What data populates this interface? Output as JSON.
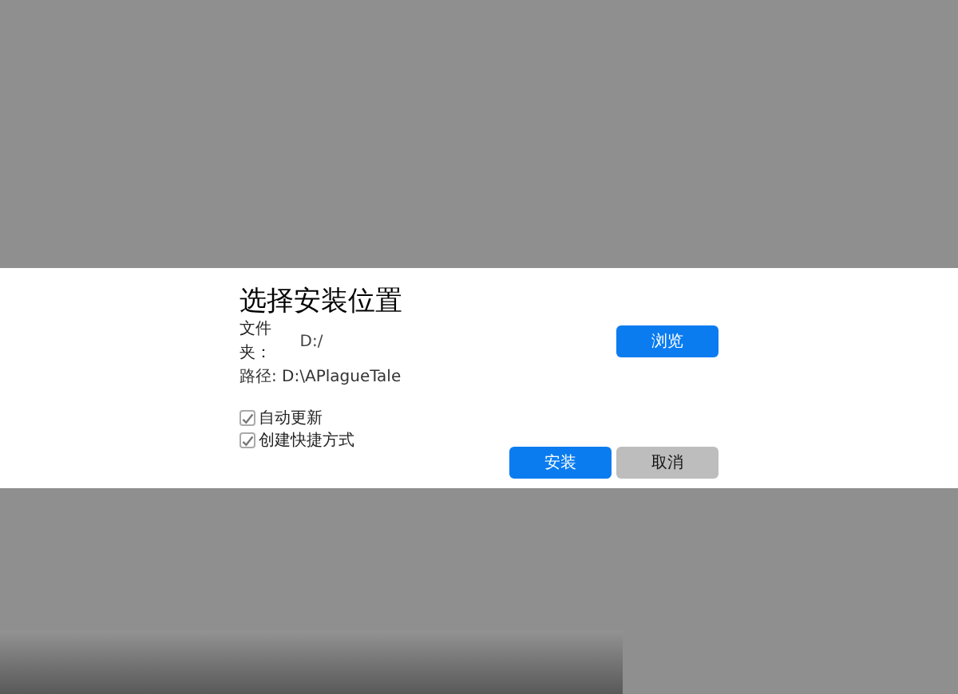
{
  "dialog": {
    "title": "选择安装位置",
    "folder": {
      "label": "文件夹：",
      "value": "D:/"
    },
    "browse_button": "浏览",
    "path": {
      "label": "路径:",
      "value": "D:\\APlagueTale"
    },
    "options": [
      {
        "label": "自动更新",
        "checked": true
      },
      {
        "label": "创建快捷方式",
        "checked": true
      }
    ],
    "buttons": [
      {
        "label": "安装",
        "kind": "primary"
      },
      {
        "label": "取消",
        "kind": "secondary"
      }
    ]
  }
}
